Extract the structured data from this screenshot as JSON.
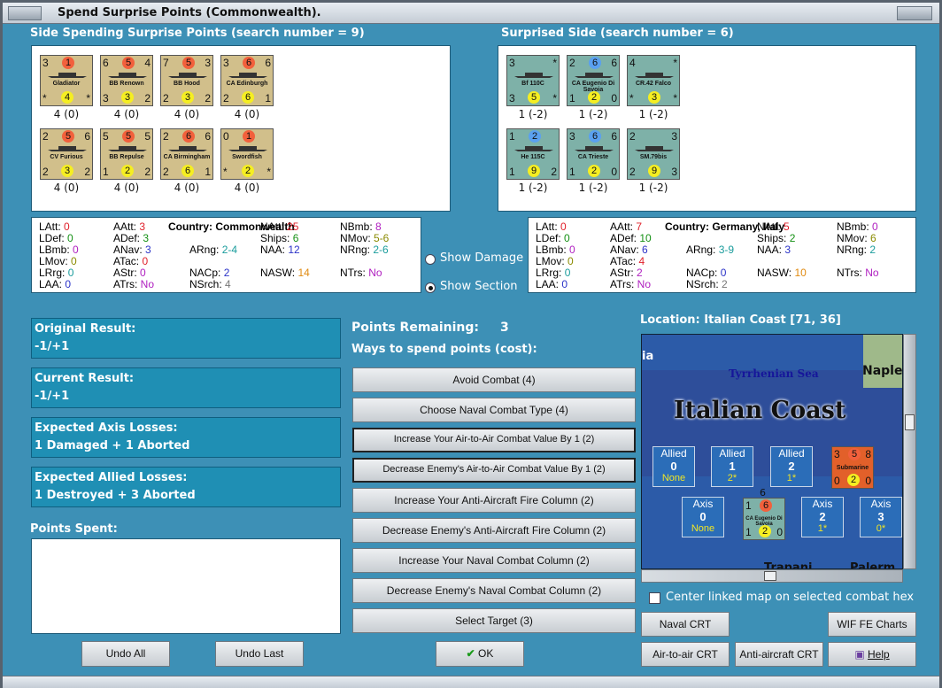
{
  "window": {
    "title": "Spend Surprise Points (Commonwealth)."
  },
  "left": {
    "heading": "Side Spending Surprise Points (search number = 9)",
    "units": [
      {
        "tl": "3",
        "tc": "1",
        "tr": "",
        "name": "Gladiator",
        "bl": "*",
        "bc": "4",
        "br": "*",
        "count": "4 (0)",
        "col": "tan"
      },
      {
        "tl": "6",
        "tc": "5",
        "tr": "4",
        "name": "BB Renown",
        "bl": "3",
        "bc": "3",
        "br": "2",
        "count": "4 (0)",
        "col": "tan"
      },
      {
        "tl": "7",
        "tc": "5",
        "tr": "3",
        "name": "BB Hood",
        "bl": "2",
        "bc": "3",
        "br": "2",
        "count": "4 (0)",
        "col": "tan"
      },
      {
        "tl": "3",
        "tc": "6",
        "tr": "6",
        "name": "CA Edinburgh",
        "bl": "2",
        "bc": "6",
        "br": "1",
        "count": "4 (0)",
        "col": "tan"
      },
      {
        "tl": "2",
        "tc": "5",
        "tr": "6",
        "name": "CV Furious",
        "bl": "2",
        "bc": "3",
        "br": "2",
        "count": "4 (0)",
        "col": "tan"
      },
      {
        "tl": "5",
        "tc": "5",
        "tr": "5",
        "name": "BB Repulse",
        "bl": "1",
        "bc": "2",
        "br": "2",
        "count": "4 (0)",
        "col": "tan"
      },
      {
        "tl": "2",
        "tc": "6",
        "tr": "6",
        "name": "CA Birmingham",
        "bl": "2",
        "bc": "6",
        "br": "1",
        "count": "4 (0)",
        "col": "tan"
      },
      {
        "tl": "0",
        "tc": "1",
        "tr": "",
        "name": "Swordfish",
        "bl": "*",
        "bc": "2",
        "br": "*",
        "count": "4 (0)",
        "col": "tan"
      }
    ]
  },
  "right": {
    "heading": "Surprised Side (search number = 6)",
    "units": [
      {
        "tl": "3",
        "tc": "",
        "tr": "*",
        "name": "Bf 110C",
        "bl": "3",
        "bc": "5",
        "br": "*",
        "count": "1 (-2)",
        "col": "teal"
      },
      {
        "tl": "2",
        "tc": "6",
        "tr": "6",
        "name": "CA Eugenio Di Savoia",
        "bl": "1",
        "bc": "2",
        "br": "0",
        "count": "1 (-2)",
        "col": "teal"
      },
      {
        "tl": "4",
        "tc": "",
        "tr": "*",
        "name": "CR.42 Falco",
        "bl": "*",
        "bc": "3",
        "br": "*",
        "count": "1 (-2)",
        "col": "teal"
      },
      {
        "tl": "1",
        "tc": "2",
        "tr": "",
        "name": "He 115C",
        "bl": "1",
        "bc": "9",
        "br": "2",
        "count": "1 (-2)",
        "col": "teal"
      },
      {
        "tl": "3",
        "tc": "6",
        "tr": "6",
        "name": "CA Trieste",
        "bl": "1",
        "bc": "2",
        "br": "0",
        "count": "1 (-2)",
        "col": "teal"
      },
      {
        "tl": "2",
        "tc": "",
        "tr": "3",
        "name": "SM.79bis",
        "bl": "2",
        "bc": "9",
        "br": "3",
        "count": "1 (-2)",
        "col": "teal"
      }
    ]
  },
  "stats_left": {
    "country": "Country: Commonwealth",
    "LAtt": "0",
    "AAtt": "3",
    "NAtt": "25",
    "NBmb": "8",
    "LDef": "0",
    "ADef": "3",
    "Ships": "6",
    "NMov": "5-6",
    "LBmb": "0",
    "ANav": "3",
    "ARng": "2-4",
    "NAA": "12",
    "NRng": "2-6",
    "LMov": "0",
    "ATac": "0",
    "LRrg": "0",
    "AStr": "0",
    "NACp": "2",
    "NASW": "14",
    "NTrs": "No",
    "LAA": "0",
    "ATrs": "No",
    "NSrch": "4"
  },
  "stats_right": {
    "country": "Country: Germany, Italy",
    "LAtt": "0",
    "AAtt": "7",
    "NAtt": "5",
    "NBmb": "0",
    "LDef": "0",
    "ADef": "10",
    "Ships": "2",
    "NMov": "6",
    "LBmb": "0",
    "ANav": "6",
    "ARng": "3-9",
    "NAA": "3",
    "NRng": "2",
    "LMov": "0",
    "ATac": "4",
    "LRrg": "0",
    "AStr": "2",
    "NACp": "0",
    "NASW": "10",
    "NTrs": "No",
    "LAA": "0",
    "ATrs": "No",
    "NSrch": "2"
  },
  "show_damage": "Show Damage",
  "show_section": "Show Section",
  "results": [
    {
      "label": "Original Result:",
      "value": "-1/+1"
    },
    {
      "label": "Current Result:",
      "value": "-1/+1"
    },
    {
      "label": "Expected Axis Losses:",
      "value": "1 Damaged + 1 Aborted"
    },
    {
      "label": "Expected Allied Losses:",
      "value": "1 Destroyed + 3 Aborted"
    }
  ],
  "points_spent": "Points Spent:",
  "points_remaining_label": "Points Remaining:",
  "points_remaining": "3",
  "ways_label": "Ways to spend points (cost):",
  "options": [
    "Avoid Combat (4)",
    "Choose Naval Combat Type (4)",
    "Increase Your Air-to-Air Combat Value By 1 (2)",
    "Decrease Enemy's Air-to-Air Combat Value By 1 (2)",
    "Increase Your Anti-Aircraft Fire Column (2)",
    "Decrease Enemy's Anti-Aircraft Fire Column (2)",
    "Increase Your Naval Combat Column (2)",
    "Decrease Enemy's Naval Combat Column (2)",
    "Select Target (3)"
  ],
  "location": "Location: Italian Coast [71, 36]",
  "map": {
    "title": "Italian Coast",
    "sea": "Tyrrhenian Sea",
    "city1": "Naple",
    "city2": "ia",
    "city3": "Trapani",
    "city4": "Palerm",
    "allied": [
      {
        "l": "Allied",
        "n": "0",
        "y": "None"
      },
      {
        "l": "Allied",
        "n": "1",
        "y": "2*"
      },
      {
        "l": "Allied",
        "n": "2",
        "y": "1*"
      }
    ],
    "axis": [
      {
        "l": "Axis",
        "n": "0",
        "y": "None"
      },
      {
        "l": "Axis",
        "n": "2",
        "y": "1*"
      },
      {
        "l": "Axis",
        "n": "3",
        "y": "0*"
      }
    ],
    "sub": {
      "tl": "3",
      "tc": "5",
      "tr": "8",
      "name": "Submarine",
      "bl": "0",
      "bc": "2",
      "br": "0"
    },
    "ca": {
      "top": "6",
      "tl": "1",
      "tc": "6",
      "tr": "",
      "name": "CA Eugenio Di Savoia",
      "bl": "1",
      "bc": "2",
      "br": "0"
    }
  },
  "center_label": "Center linked map on selected combat hex",
  "buttons": {
    "naval_crt": "Naval CRT",
    "fe_charts": "WIF FE Charts",
    "air_crt": "Air-to-air CRT",
    "aa_crt": "Anti-aircraft CRT",
    "help": "Help",
    "undo_all": "Undo All",
    "undo_last": "Undo Last",
    "ok": "OK"
  }
}
